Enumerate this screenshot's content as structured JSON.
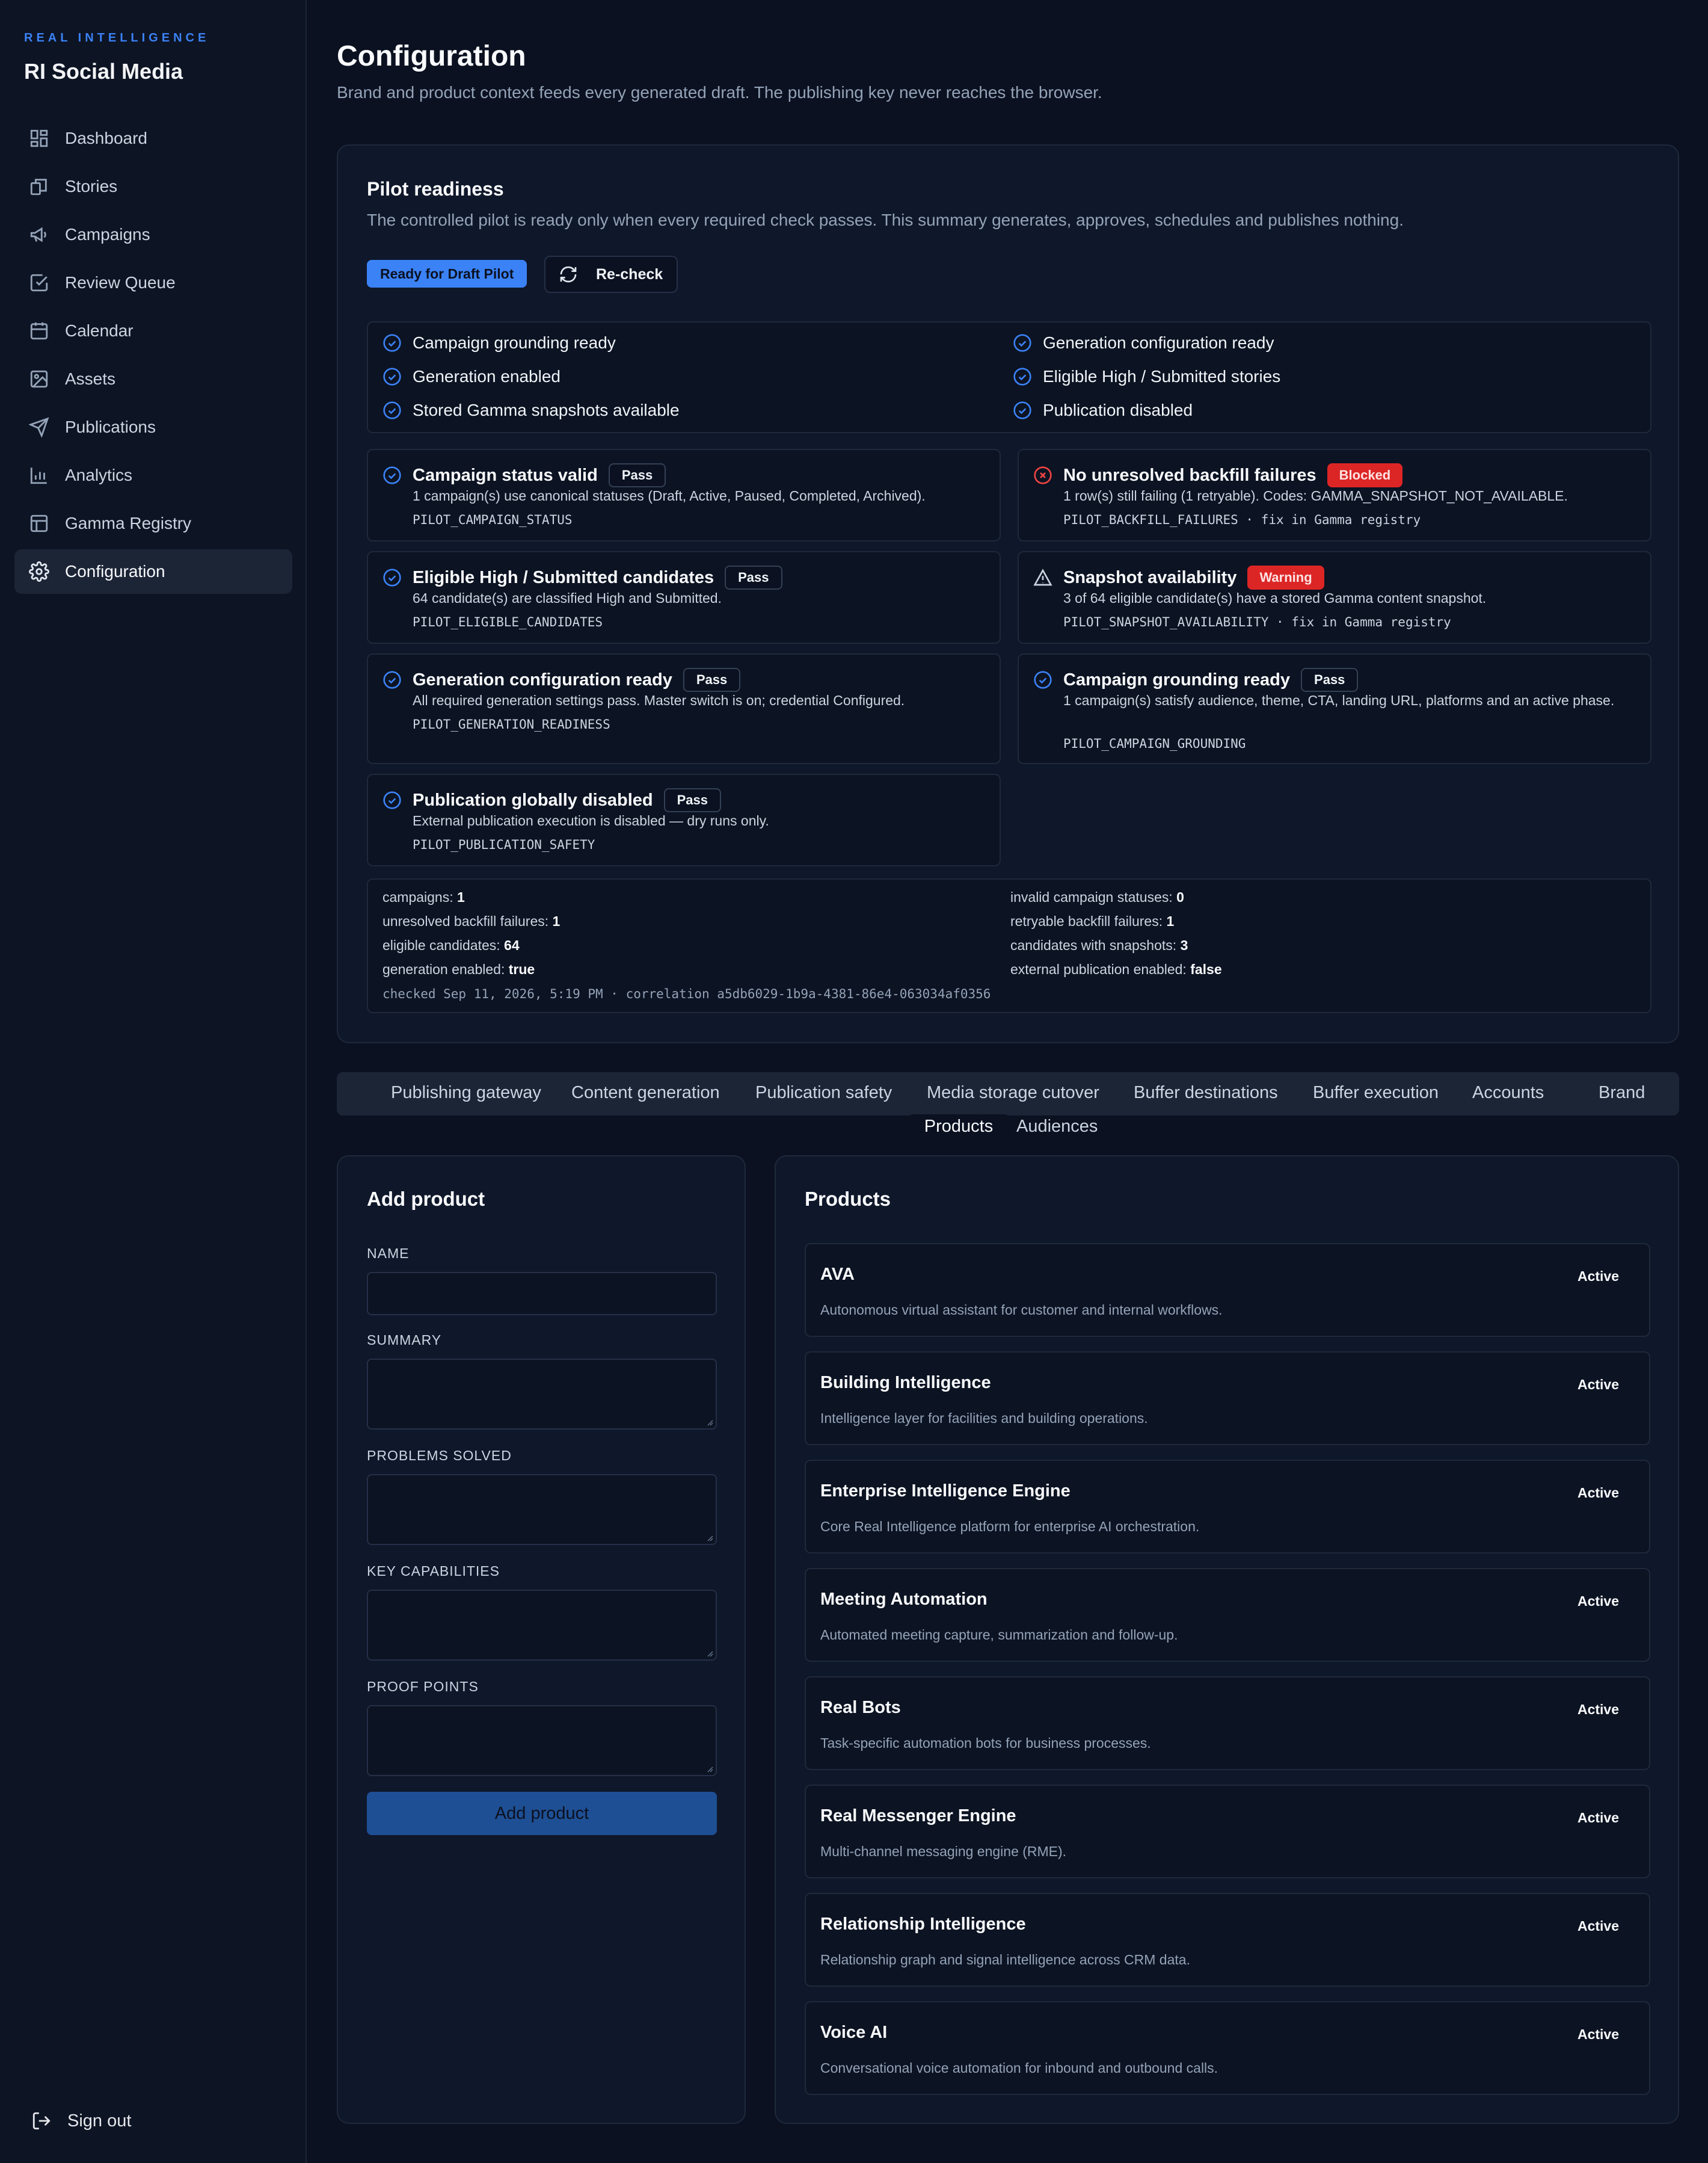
{
  "colors": {
    "accent": "#3b82f6",
    "danger": "#dc2626",
    "bg": "#0b1120",
    "panel": "#0f172a"
  },
  "brand": {
    "eyebrow": "REAL INTELLIGENCE",
    "name": "RI Social Media"
  },
  "sidebar": {
    "items": [
      {
        "label": "Dashboard",
        "icon": "dashboard-icon"
      },
      {
        "label": "Stories",
        "icon": "stories-icon"
      },
      {
        "label": "Campaigns",
        "icon": "megaphone-icon"
      },
      {
        "label": "Review Queue",
        "icon": "check-square-icon"
      },
      {
        "label": "Calendar",
        "icon": "calendar-icon"
      },
      {
        "label": "Assets",
        "icon": "image-icon"
      },
      {
        "label": "Publications",
        "icon": "send-icon"
      },
      {
        "label": "Analytics",
        "icon": "bar-chart-icon"
      },
      {
        "label": "Gamma Registry",
        "icon": "table-icon"
      },
      {
        "label": "Configuration",
        "icon": "gear-icon",
        "active": true
      }
    ],
    "signout": "Sign out"
  },
  "header": {
    "title": "Configuration",
    "subtitle": "Brand and product context feeds every generated draft. The publishing key never reaches the browser."
  },
  "pilot": {
    "title": "Pilot readiness",
    "description": "The controlled pilot is ready only when every required check passes. This summary generates, approves, schedules and publishes nothing.",
    "status_badge": "Ready for Draft Pilot",
    "recheck_label": "Re-check",
    "summary": [
      "Campaign grounding ready",
      "Generation configuration ready",
      "Generation enabled",
      "Eligible High / Submitted stories",
      "Stored Gamma snapshots available",
      "Publication disabled"
    ],
    "checks": [
      {
        "title": "Campaign status valid",
        "status": "Pass",
        "kind": "pass",
        "desc": "1 campaign(s) use canonical statuses (Draft, Active, Paused, Completed, Archived).",
        "code": "PILOT_CAMPAIGN_STATUS"
      },
      {
        "title": "No unresolved backfill failures",
        "status": "Blocked",
        "kind": "blocked",
        "desc": "1 row(s) still failing (1 retryable). Codes: GAMMA_SNAPSHOT_NOT_AVAILABLE.",
        "code": "PILOT_BACKFILL_FAILURES · fix in Gamma registry"
      },
      {
        "title": "Eligible High / Submitted candidates",
        "status": "Pass",
        "kind": "pass",
        "desc": "64 candidate(s) are classified High and Submitted.",
        "code": "PILOT_ELIGIBLE_CANDIDATES"
      },
      {
        "title": "Snapshot availability",
        "status": "Warning",
        "kind": "warning",
        "desc": "3 of 64 eligible candidate(s) have a stored Gamma content snapshot.",
        "code": "PILOT_SNAPSHOT_AVAILABILITY · fix in Gamma registry"
      },
      {
        "title": "Generation configuration ready",
        "status": "Pass",
        "kind": "pass",
        "desc": "All required generation settings pass. Master switch is on; credential Configured.",
        "code": "PILOT_GENERATION_READINESS"
      },
      {
        "title": "Campaign grounding ready",
        "status": "Pass",
        "kind": "pass",
        "desc": "1 campaign(s) satisfy audience, theme, CTA, landing URL, platforms and an active phase.",
        "code": "PILOT_CAMPAIGN_GROUNDING"
      },
      {
        "title": "Publication globally disabled",
        "status": "Pass",
        "kind": "pass",
        "desc": "External publication execution is disabled — dry runs only.",
        "code": "PILOT_PUBLICATION_SAFETY"
      }
    ],
    "stats": [
      {
        "label": "campaigns:",
        "value": "1"
      },
      {
        "label": "invalid campaign statuses:",
        "value": "0"
      },
      {
        "label": "unresolved backfill failures:",
        "value": "1"
      },
      {
        "label": "retryable backfill failures:",
        "value": "1"
      },
      {
        "label": "eligible candidates:",
        "value": "64"
      },
      {
        "label": "candidates with snapshots:",
        "value": "3"
      },
      {
        "label": "generation enabled:",
        "value": "true"
      },
      {
        "label": "external publication enabled:",
        "value": "false"
      }
    ],
    "checked_line": "checked Sep 11, 2026, 5:19 PM · correlation a5db6029-1b9a-4381-86e4-063034af0356"
  },
  "tabs": [
    {
      "label": "Publishing gateway"
    },
    {
      "label": "Content generation"
    },
    {
      "label": "Publication safety"
    },
    {
      "label": "Media storage cutover"
    },
    {
      "label": "Buffer destinations"
    },
    {
      "label": "Buffer execution"
    },
    {
      "label": "Accounts"
    },
    {
      "label": "Brand"
    },
    {
      "label": "Products",
      "active": true
    },
    {
      "label": "Audiences"
    }
  ],
  "add_product": {
    "title": "Add product",
    "fields": [
      {
        "label": "NAME",
        "value": ""
      },
      {
        "label": "SUMMARY",
        "value": ""
      },
      {
        "label": "PROBLEMS SOLVED",
        "value": ""
      },
      {
        "label": "KEY CAPABILITIES",
        "value": ""
      },
      {
        "label": "PROOF POINTS",
        "value": ""
      }
    ],
    "submit_label": "Add product"
  },
  "products": {
    "title": "Products",
    "items": [
      {
        "name": "AVA",
        "status": "Active",
        "desc": "Autonomous virtual assistant for customer and internal workflows."
      },
      {
        "name": "Building Intelligence",
        "status": "Active",
        "desc": "Intelligence layer for facilities and building operations."
      },
      {
        "name": "Enterprise Intelligence Engine",
        "status": "Active",
        "desc": "Core Real Intelligence platform for enterprise AI orchestration."
      },
      {
        "name": "Meeting Automation",
        "status": "Active",
        "desc": "Automated meeting capture, summarization and follow-up."
      },
      {
        "name": "Real Bots",
        "status": "Active",
        "desc": "Task-specific automation bots for business processes."
      },
      {
        "name": "Real Messenger Engine",
        "status": "Active",
        "desc": "Multi-channel messaging engine (RME)."
      },
      {
        "name": "Relationship Intelligence",
        "status": "Active",
        "desc": "Relationship graph and signal intelligence across CRM data."
      },
      {
        "name": "Voice AI",
        "status": "Active",
        "desc": "Conversational voice automation for inbound and outbound calls."
      }
    ]
  }
}
